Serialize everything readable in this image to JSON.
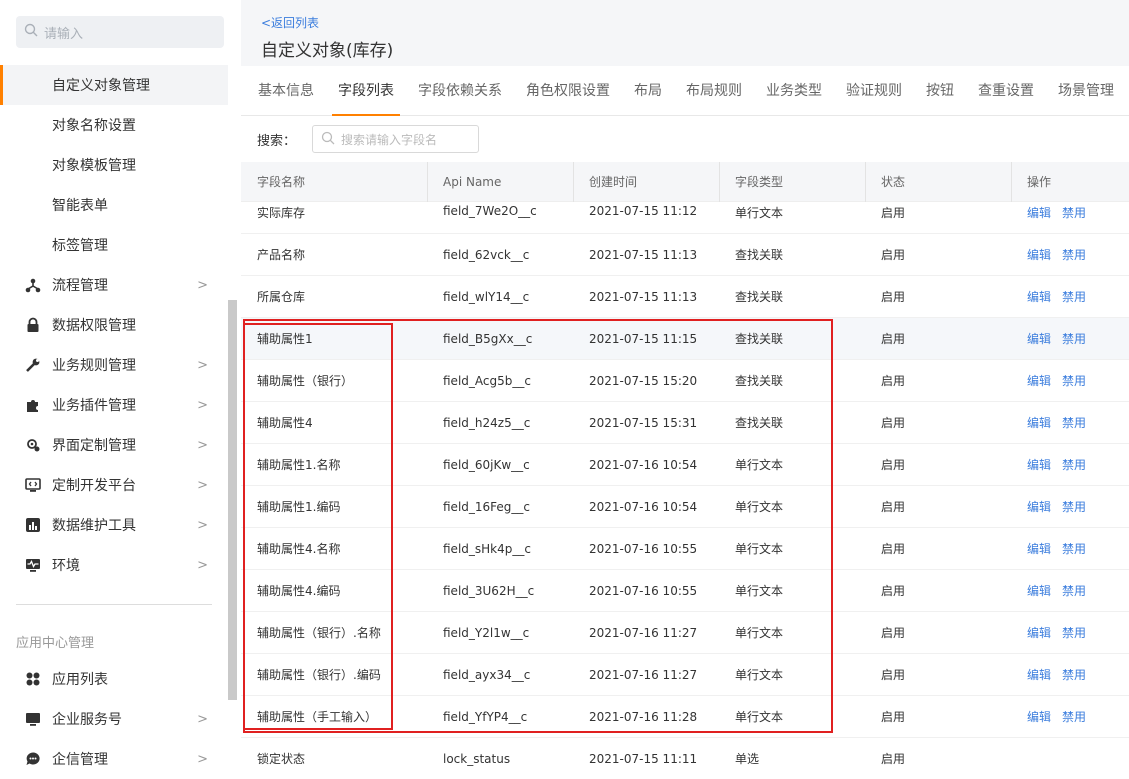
{
  "sidebar": {
    "search_placeholder": "请输入",
    "sub_items": [
      "自定义对象管理",
      "对象名称设置",
      "对象模板管理",
      "智能表单",
      "标签管理"
    ],
    "top_items": [
      {
        "label": "流程管理",
        "icon": "flow-icon",
        "chevron": true
      },
      {
        "label": "数据权限管理",
        "icon": "lock-icon",
        "chevron": false
      },
      {
        "label": "业务规则管理",
        "icon": "wrench-icon",
        "chevron": true
      },
      {
        "label": "业务插件管理",
        "icon": "puzzle-icon",
        "chevron": true
      },
      {
        "label": "界面定制管理",
        "icon": "palette-icon",
        "chevron": true
      },
      {
        "label": "定制开发平台",
        "icon": "code-monitor-icon",
        "chevron": true
      },
      {
        "label": "数据维护工具",
        "icon": "bar-chart-icon",
        "chevron": true
      },
      {
        "label": "环境",
        "icon": "pulse-monitor-icon",
        "chevron": true
      }
    ],
    "section_title": "应用中心管理",
    "app_items": [
      {
        "label": "应用列表",
        "icon": "grid-icon",
        "chevron": false
      },
      {
        "label": "企业服务号",
        "icon": "monitor-icon",
        "chevron": true
      },
      {
        "label": "企信管理",
        "icon": "chat-icon",
        "chevron": true
      }
    ]
  },
  "header": {
    "back_label": "<返回列表",
    "title": "自定义对象(库存)"
  },
  "tabs": [
    "基本信息",
    "字段列表",
    "字段依赖关系",
    "角色权限设置",
    "布局",
    "布局规则",
    "业务类型",
    "验证规则",
    "按钮",
    "查重设置",
    "场景管理"
  ],
  "active_tab": "字段列表",
  "search": {
    "label": "搜索：",
    "placeholder": "搜索请输入字段名"
  },
  "table": {
    "columns": [
      "字段名称",
      "Api Name",
      "创建时间",
      "字段类型",
      "状态",
      "操作"
    ],
    "edit_label": "编辑",
    "disable_label": "禁用",
    "rows": [
      {
        "name": "实际库存",
        "api": "field_7We2O__c",
        "time": "2021-07-15 11:12",
        "type": "单行文本",
        "status": "启用"
      },
      {
        "name": "产品名称",
        "api": "field_62vck__c",
        "time": "2021-07-15 11:13",
        "type": "查找关联",
        "status": "启用"
      },
      {
        "name": "所属仓库",
        "api": "field_wlY14__c",
        "time": "2021-07-15 11:13",
        "type": "查找关联",
        "status": "启用"
      },
      {
        "name": "辅助属性1",
        "api": "field_B5gXx__c",
        "time": "2021-07-15 11:15",
        "type": "查找关联",
        "status": "启用"
      },
      {
        "name": "辅助属性（银行）",
        "api": "field_Acg5b__c",
        "time": "2021-07-15 15:20",
        "type": "查找关联",
        "status": "启用"
      },
      {
        "name": "辅助属性4",
        "api": "field_h24z5__c",
        "time": "2021-07-15 15:31",
        "type": "查找关联",
        "status": "启用"
      },
      {
        "name": "辅助属性1.名称",
        "api": "field_60jKw__c",
        "time": "2021-07-16 10:54",
        "type": "单行文本",
        "status": "启用"
      },
      {
        "name": "辅助属性1.编码",
        "api": "field_16Feg__c",
        "time": "2021-07-16 10:54",
        "type": "单行文本",
        "status": "启用"
      },
      {
        "name": "辅助属性4.名称",
        "api": "field_sHk4p__c",
        "time": "2021-07-16 10:55",
        "type": "单行文本",
        "status": "启用"
      },
      {
        "name": "辅助属性4.编码",
        "api": "field_3U62H__c",
        "time": "2021-07-16 10:55",
        "type": "单行文本",
        "status": "启用"
      },
      {
        "name": "辅助属性（银行）.名称",
        "api": "field_Y2l1w__c",
        "time": "2021-07-16 11:27",
        "type": "单行文本",
        "status": "启用"
      },
      {
        "name": "辅助属性（银行）.编码",
        "api": "field_ayx34__c",
        "time": "2021-07-16 11:27",
        "type": "单行文本",
        "status": "启用"
      },
      {
        "name": "辅助属性（手工输入）",
        "api": "field_YfYP4__c",
        "time": "2021-07-16 11:28",
        "type": "单行文本",
        "status": "启用"
      },
      {
        "name": "锁定状态",
        "api": "lock_status",
        "time": "2021-07-15 11:11",
        "type": "单选",
        "status": "启用"
      }
    ]
  },
  "colors": {
    "accent": "#ff8000",
    "link": "#3b7ddd",
    "highlight_box": "#e02020"
  }
}
